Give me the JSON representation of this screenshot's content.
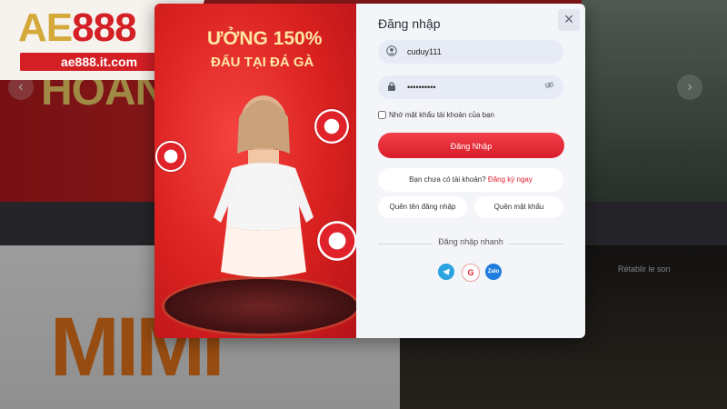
{
  "brand": {
    "logo_ae": "AE",
    "logo_num": "888",
    "logo_url": "ae888.it.com"
  },
  "background": {
    "banner_text": "HOANG",
    "promo_text": "MIMI",
    "retablir": "Rétablir le son"
  },
  "promo": {
    "headline1": "ƯỞNG 150%",
    "headline2": "ĐẤU TẠI ĐÁ GÀ"
  },
  "login": {
    "title": "Đăng nhập",
    "close_icon": "×",
    "username_value": "cuduy111",
    "password_value": "••••••••••",
    "remember_label": "Nhớ mật khẩu tài khoản của bạn",
    "login_button": "Đăng Nhập",
    "no_account_text": "Bạn chưa có tài khoản?",
    "register_link": "Đăng ký ngay",
    "forgot_username": "Quên tên đăng nhập",
    "forgot_password": "Quên mật khẩu",
    "quick_login_title": "Đăng nhập nhanh",
    "social": {
      "telegram": "telegram-icon",
      "google": "G",
      "zalo": "Zalo"
    }
  },
  "colors": {
    "primary": "#e0202c",
    "brand_gold": "#d4a93a",
    "panel_bg": "#f4f5f9"
  }
}
